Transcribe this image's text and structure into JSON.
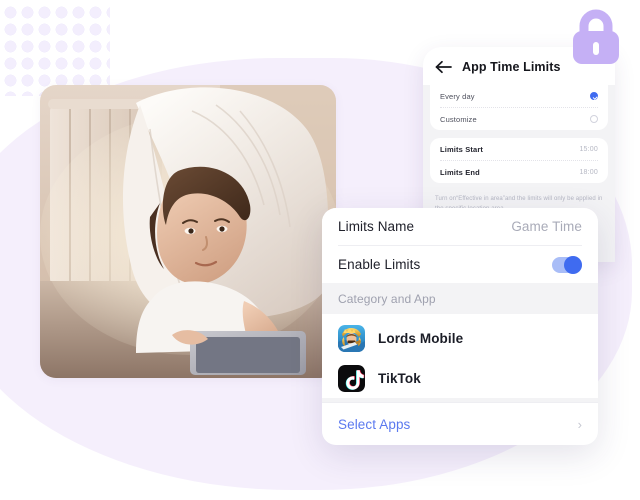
{
  "decor": {
    "dot_grid": "dot-grid-pattern",
    "blob_color": "#f5effc",
    "lock_icon": "lock-icon",
    "lock_color": "#c5b0f5"
  },
  "photo": {
    "alt": "child lying under a white blanket looking at a tablet"
  },
  "phone_panel": {
    "back_icon": "arrow-left-icon",
    "title": "App Time Limits",
    "schedule": {
      "options": [
        {
          "label": "Every day",
          "selected": true
        },
        {
          "label": "Customize",
          "selected": false
        }
      ]
    },
    "times": [
      {
        "label": "Limits Start",
        "value": "15:00"
      },
      {
        "label": "Limits End",
        "value": "18:00"
      }
    ],
    "note": "Turn on“Effective in area”and the limits will only be applied in the specific location area"
  },
  "main_card": {
    "limits_name_label": "Limits Name",
    "limits_name_value": "Game Time",
    "enable_limits_label": "Enable Limits",
    "enable_limits_on": true,
    "category_title": "Category and App",
    "apps": [
      {
        "name": "Lords Mobile",
        "icon": "lords-mobile-icon"
      },
      {
        "name": "TikTok",
        "icon": "tiktok-icon"
      }
    ],
    "select_apps_label": "Select Apps",
    "select_apps_chevron": "›",
    "accent_color": "#3f6bf0",
    "link_color": "#5b79ef"
  }
}
